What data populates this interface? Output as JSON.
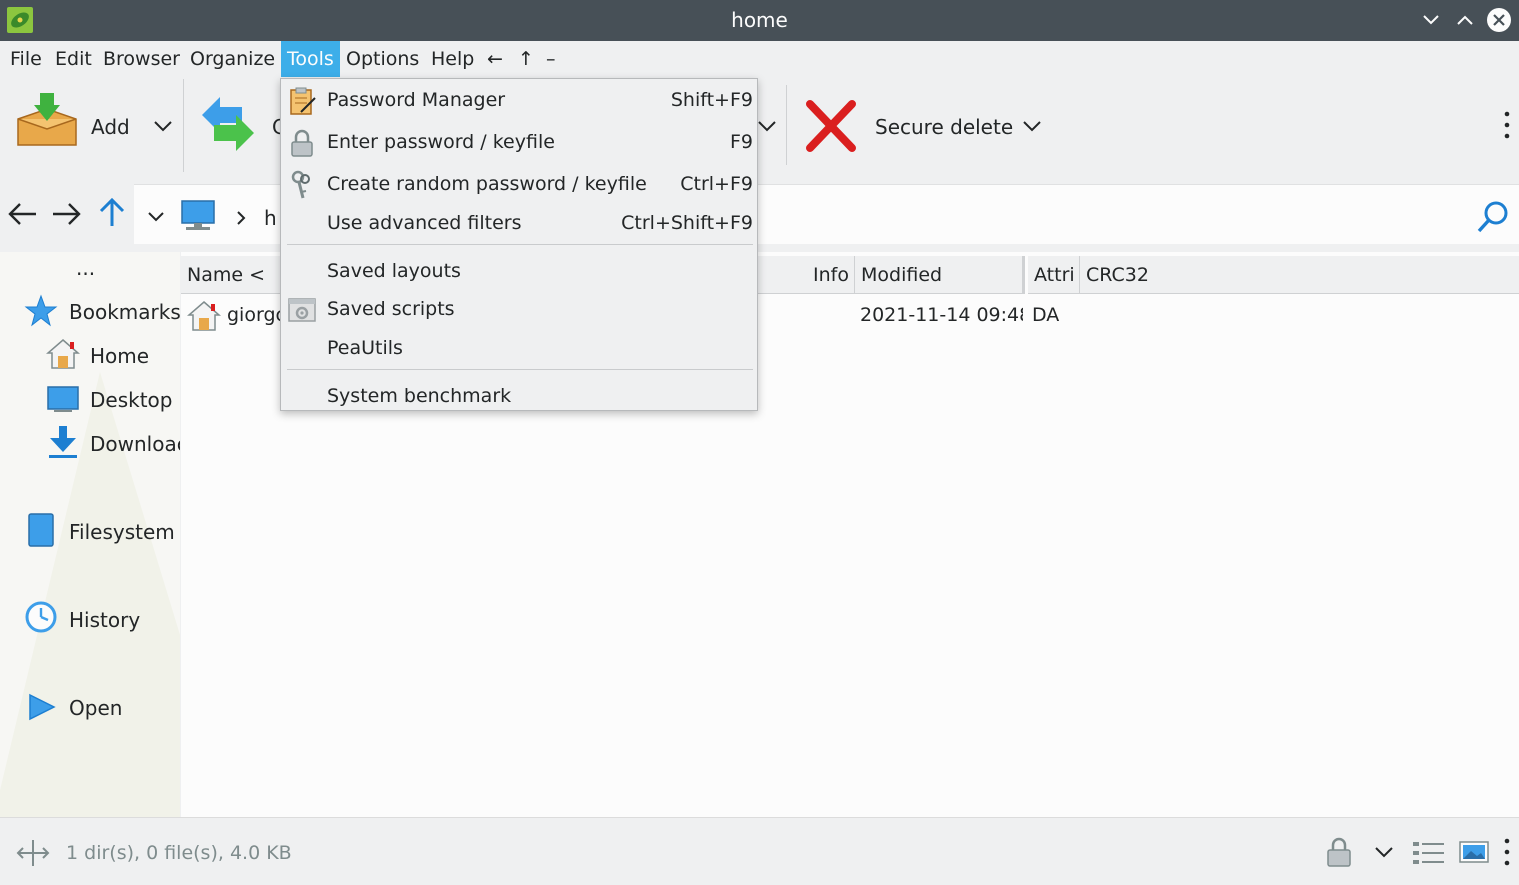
{
  "window": {
    "title": "home"
  },
  "menubar": {
    "items": [
      "File",
      "Edit",
      "Browser",
      "Organize",
      "Tools",
      "Options",
      "Help"
    ],
    "extra": [
      "←",
      "↑",
      "–"
    ]
  },
  "toolbar": {
    "add_label": "Add",
    "convert_label": "C",
    "secure_delete_label": "Secure delete"
  },
  "address": {
    "path_partial": "h"
  },
  "sidebar": {
    "more": "...",
    "bookmarks": "Bookmarks",
    "home": "Home",
    "desktop": "Desktop",
    "downloads": "Downloac",
    "filesystem": "Filesystem",
    "history": "History",
    "open": "Open"
  },
  "filelist": {
    "columns": [
      "Name <",
      "Info",
      "Modified",
      "Attri",
      "CRC32"
    ],
    "rows": [
      {
        "name": "giorgc",
        "modified": "2021-11-14 09:48:",
        "attrib": "DA"
      }
    ]
  },
  "status": {
    "text": "1 dir(s), 0 file(s), 4.0 KB"
  },
  "tools_menu": {
    "items": [
      {
        "label": "Password Manager",
        "shortcut": "Shift+F9"
      },
      {
        "label": "Enter password / keyfile",
        "shortcut": "F9"
      },
      {
        "label": "Create random password / keyfile",
        "shortcut": "Ctrl+F9"
      },
      {
        "label": "Use advanced filters",
        "shortcut": "Ctrl+Shift+F9"
      },
      {
        "label": "Saved layouts",
        "shortcut": ""
      },
      {
        "label": "Saved scripts",
        "shortcut": ""
      },
      {
        "label": "PeaUtils",
        "shortcut": ""
      },
      {
        "label": "System benchmark",
        "shortcut": ""
      }
    ]
  },
  "colors": {
    "accent": "#3daee9",
    "titlebar": "#475057",
    "delete_red": "#da1f1f"
  }
}
